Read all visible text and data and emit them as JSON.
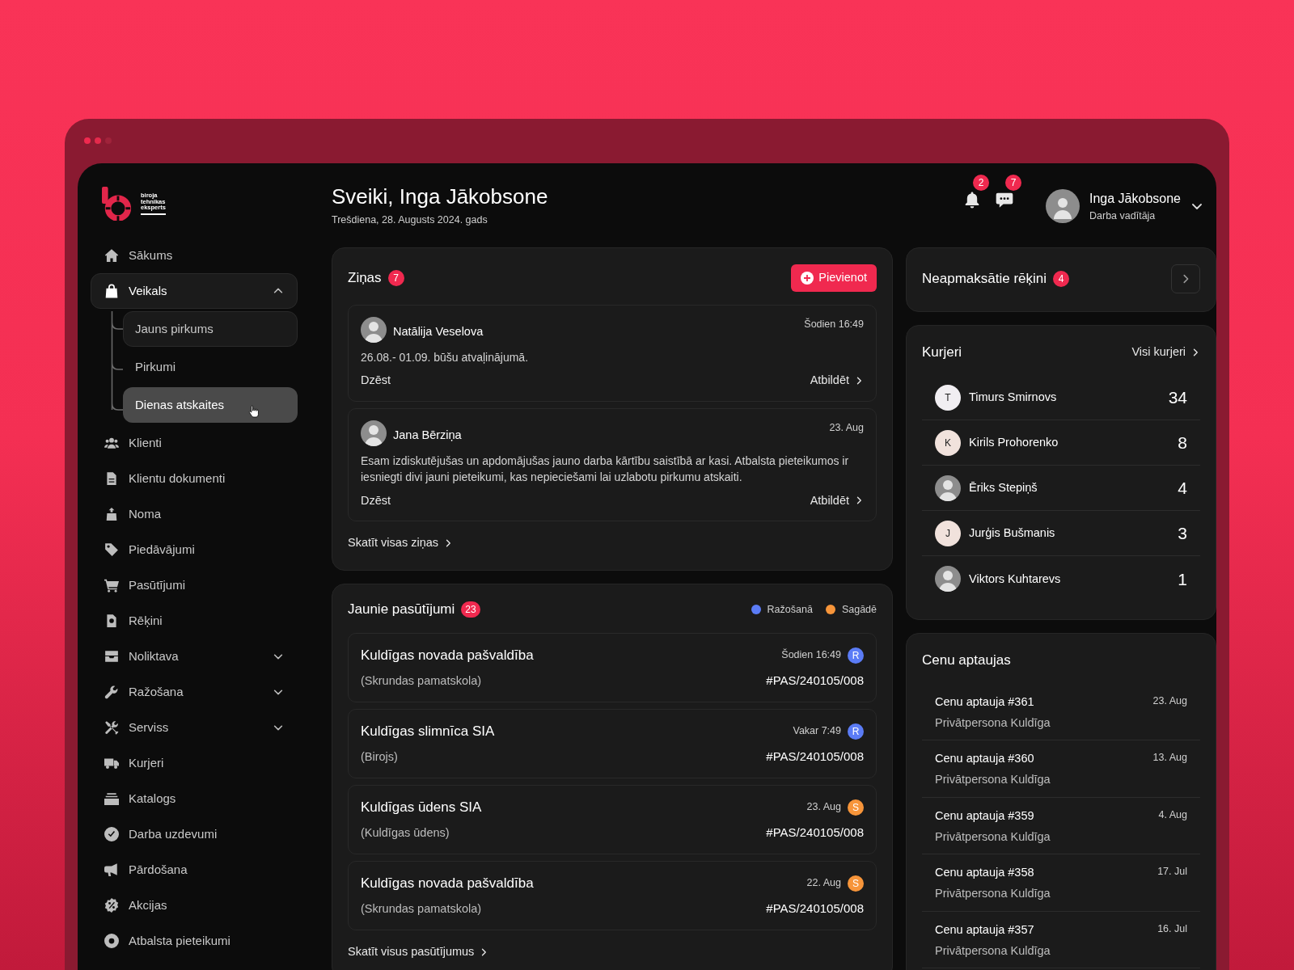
{
  "logo": {
    "lines": [
      "biroja",
      "tehnikas",
      "eksperts"
    ]
  },
  "nav": [
    {
      "label": "Sākums",
      "kind": "link",
      "expanded": false
    },
    {
      "label": "Veikals",
      "kind": "group",
      "expanded": true,
      "children": [
        {
          "label": "Jauns pirkums",
          "outlined": true,
          "selected": false,
          "pointer": false
        },
        {
          "label": "Pirkumi",
          "outlined": false,
          "selected": false,
          "pointer": false
        },
        {
          "label": "Dienas atskaites",
          "outlined": false,
          "selected": true,
          "pointer": true
        }
      ]
    },
    {
      "label": "Klienti",
      "kind": "link",
      "expanded": false
    },
    {
      "label": "Klientu dokumenti",
      "kind": "link",
      "expanded": false
    },
    {
      "label": "Noma",
      "kind": "link",
      "expanded": false
    },
    {
      "label": "Piedāvājumi",
      "kind": "link",
      "expanded": false
    },
    {
      "label": "Pasūtījumi",
      "kind": "link",
      "expanded": false
    },
    {
      "label": "Rēķini",
      "kind": "link",
      "expanded": false
    },
    {
      "label": "Noliktava",
      "kind": "group",
      "expanded": false
    },
    {
      "label": "Ražošana",
      "kind": "group",
      "expanded": false
    },
    {
      "label": "Serviss",
      "kind": "group",
      "expanded": false
    },
    {
      "label": "Kurjeri",
      "kind": "link",
      "expanded": false
    },
    {
      "label": "Katalogs",
      "kind": "link",
      "expanded": false
    },
    {
      "label": "Darba uzdevumi",
      "kind": "link",
      "expanded": false
    },
    {
      "label": "Pārdošana",
      "kind": "link",
      "expanded": false
    },
    {
      "label": "Akcijas",
      "kind": "link",
      "expanded": false
    },
    {
      "label": "Atbalsta pieteikumi",
      "kind": "link",
      "expanded": false
    }
  ],
  "header": {
    "greeting": "Sveiki, Inga Jākobsone",
    "date": "Trešdiena, 28. Augusts 2024. gads",
    "alerts": [
      {
        "count": "2"
      },
      {
        "count": "7"
      }
    ],
    "user": {
      "name": "Inga Jākobsone",
      "role": "Darba vadītāja"
    }
  },
  "news": {
    "title": "Ziņas",
    "count": "7",
    "add_button": "Pievienot",
    "messages": [
      {
        "author": "Natālija Veselova",
        "time": "Šodien 16:49",
        "text": "26.08.- 01.09. būšu atvaļinājumā.",
        "delete": "Dzēst",
        "reply": "Atbildēt"
      },
      {
        "author": "Jana Bērziņa",
        "time": "23. Aug",
        "text": "Esam izdiskutējušas un apdomājušas jauno darba kārtību saistībā ar kasi. Atbalsta pieteikumos ir iesniegti divi jauni pieteikumi, kas nepieciešami lai uzlabotu pirkumu atskaiti.",
        "delete": "Dzēst",
        "reply": "Atbildēt"
      }
    ],
    "footer_link": "Skatīt visas ziņas"
  },
  "orders": {
    "title": "Jaunie pasūtījumi",
    "count": "23",
    "legend": [
      {
        "label": "Ražošanā",
        "color": "#5b7cf6"
      },
      {
        "label": "Sagādē",
        "color": "#f7953a"
      }
    ],
    "list": [
      {
        "name": "Kuldīgas novada pašvaldība",
        "sub": "(Skrundas pamatskola)",
        "time": "Šodien 16:49",
        "status": "R",
        "color": "#5b7cf6",
        "number": "#PAS/240105/008"
      },
      {
        "name": "Kuldīgas slimnīca SIA",
        "sub": "(Birojs)",
        "time": "Vakar 7:49",
        "status": "R",
        "color": "#5b7cf6",
        "number": "#PAS/240105/008"
      },
      {
        "name": "Kuldīgas ūdens SIA",
        "sub": "(Kuldīgas ūdens)",
        "time": "23. Aug",
        "status": "S",
        "color": "#f7953a",
        "number": "#PAS/240105/008"
      },
      {
        "name": "Kuldīgas novada pašvaldība",
        "sub": "(Skrundas pamatskola)",
        "time": "22. Aug",
        "status": "S",
        "color": "#f7953a",
        "number": "#PAS/240105/008"
      }
    ],
    "footer_link": "Skatīt visus pasūtījumus"
  },
  "invoices": {
    "title": "Neapmaksātie rēķini",
    "count": "4"
  },
  "couriers": {
    "title": "Kurjeri",
    "link": "Visi kurjeri",
    "list": [
      {
        "name": "Timurs Smirnovs",
        "count": "34",
        "letter": "T",
        "color": "#f1eef2"
      },
      {
        "name": "Kirils Prohorenko",
        "count": "8",
        "letter": "K",
        "color": "#f1e2dc"
      },
      {
        "name": "Ēriks Stepiņš",
        "count": "4"
      },
      {
        "name": "Jurģis Bušmanis",
        "count": "3",
        "letter": "J",
        "color": "#f1e2dc"
      },
      {
        "name": "Viktors Kuhtarevs",
        "count": "1"
      }
    ]
  },
  "quotes": {
    "title": "Cenu aptaujas",
    "list": [
      {
        "title": "Cenu aptauja #361",
        "date": "23. Aug",
        "client": "Privātpersona Kuldīga"
      },
      {
        "title": "Cenu aptauja #360",
        "date": "13. Aug",
        "client": "Privātpersona Kuldīga"
      },
      {
        "title": "Cenu aptauja #359",
        "date": "4. Aug",
        "client": "Privātpersona Kuldīga"
      },
      {
        "title": "Cenu aptauja #358",
        "date": "17. Jul",
        "client": "Privātpersona Kuldīga"
      },
      {
        "title": "Cenu aptauja #357",
        "date": "16. Jul",
        "client": "Privātpersona Kuldīga"
      }
    ]
  }
}
